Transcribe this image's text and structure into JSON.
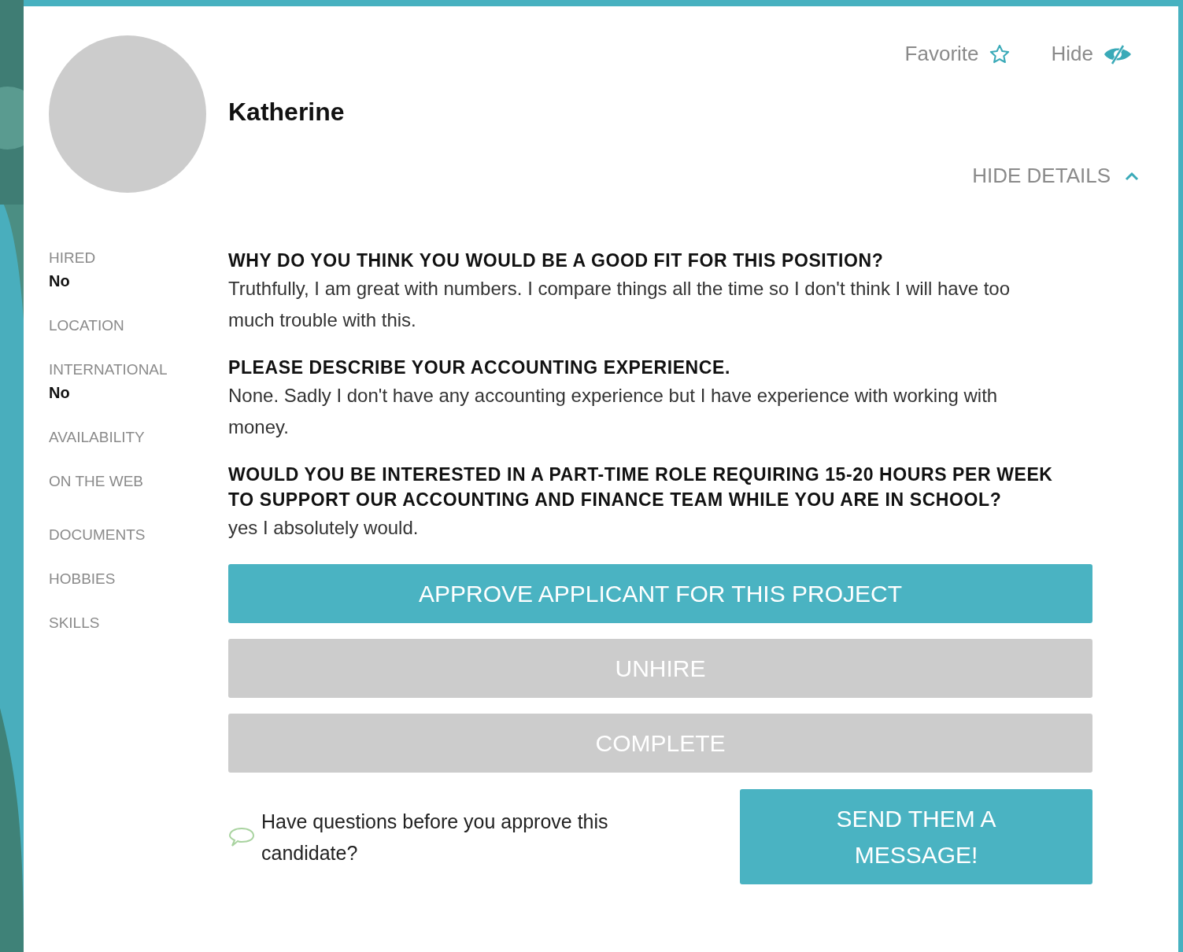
{
  "profile": {
    "name": "Katherine"
  },
  "actions": [
    {
      "label": "Favorite",
      "kind": "favorite"
    },
    {
      "label": "Hide",
      "kind": "hide"
    }
  ],
  "details_toggle": {
    "label": "HIDE DETAILS",
    "expanded": true
  },
  "fields": [
    {
      "label": "HIRED",
      "value": "No"
    },
    {
      "label": "LOCATION"
    },
    {
      "label": "INTERNATIONAL",
      "value": "No"
    },
    {
      "label": "AVAILABILITY"
    },
    {
      "label": "ON THE WEB"
    },
    {
      "label": "DOCUMENTS"
    },
    {
      "label": "HOBBIES"
    },
    {
      "label": "SKILLS"
    }
  ],
  "questions": [
    {
      "question": "WHY DO YOU THINK YOU WOULD BE A GOOD FIT FOR THIS POSITION?",
      "answer": "Truthfully, I am great with numbers. I compare things all the time so I don't think I will have too much trouble with this."
    },
    {
      "question": "PLEASE DESCRIBE YOUR ACCOUNTING EXPERIENCE.",
      "answer": "None. Sadly I don't have any accounting experience but I have experience with working with money."
    },
    {
      "question": "WOULD YOU BE INTERESTED IN A PART-TIME ROLE REQUIRING 15-20 HOURS PER WEEK TO SUPPORT OUR ACCOUNTING AND FINANCE TEAM WHILE YOU ARE IN SCHOOL?",
      "answer": "yes I absolutely would."
    }
  ],
  "buttons": [
    {
      "label": "APPROVE APPLICANT FOR THIS PROJECT",
      "disabled": false
    },
    {
      "label": "UNHIRE",
      "disabled": true
    },
    {
      "label": "COMPLETE",
      "disabled": true
    }
  ],
  "message_prompt": {
    "text": "Have questions before you approve this candidate?",
    "button": "SEND THEM A MESSAGE!"
  }
}
